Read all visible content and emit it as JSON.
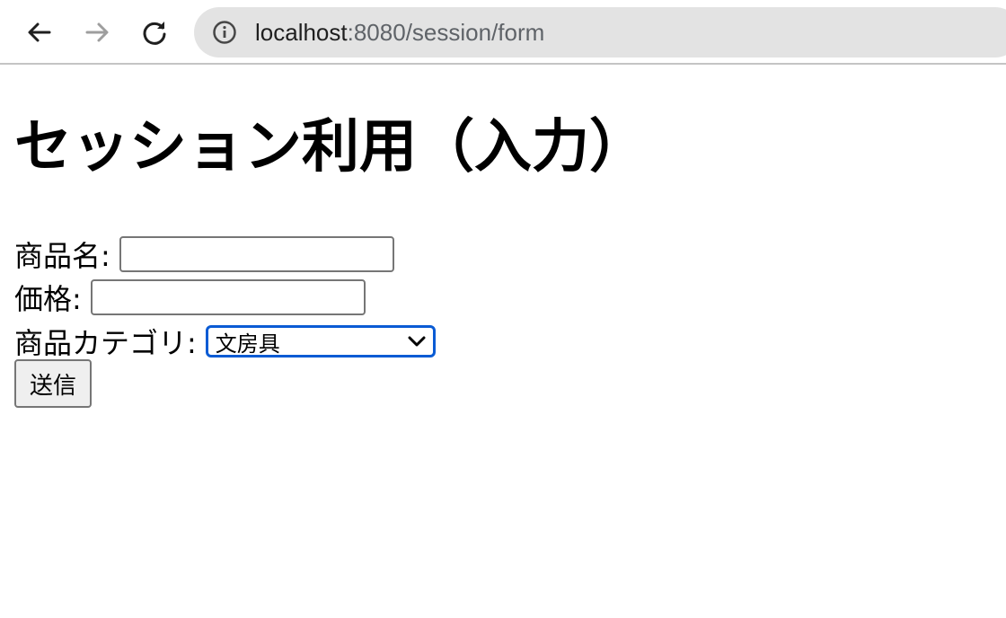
{
  "browser": {
    "url_host": "localhost",
    "url_path": ":8080/session/form",
    "icons": {
      "back": "arrow-left-icon",
      "forward": "arrow-right-icon",
      "reload": "reload-icon",
      "info": "info-icon"
    }
  },
  "page": {
    "title": "セッション利用（入力）",
    "form": {
      "product_name_label": "商品名:",
      "product_name_value": "",
      "price_label": "価格:",
      "price_value": "",
      "category_label": "商品カテゴリ:",
      "category_selected": "文房具",
      "submit_label": "送信"
    }
  },
  "colors": {
    "omnibox_bg": "#e3e3e3",
    "select_focus": "#0a5bd4",
    "button_bg": "#efefef",
    "forward_disabled": "#9e9e9e"
  }
}
